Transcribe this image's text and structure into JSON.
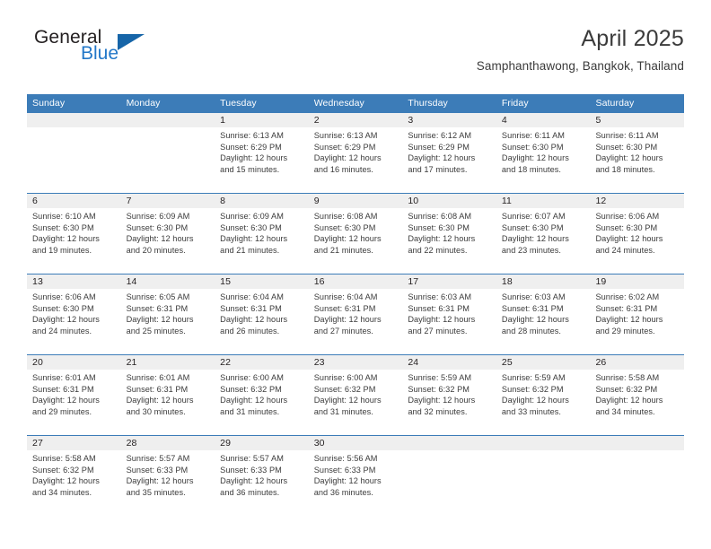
{
  "brand": {
    "name_part1": "General",
    "name_part2": "Blue",
    "flag_icon": "blue-flag-triangle-icon"
  },
  "header": {
    "title": "April 2025",
    "subtitle": "Samphanthawong, Bangkok, Thailand"
  },
  "colors": {
    "header_blue": "#3c7cb8",
    "brand_blue": "#2277c8",
    "flag_blue": "#1665a8",
    "daynum_band": "#efefef",
    "text": "#3b3b3b"
  },
  "weekdays": [
    "Sunday",
    "Monday",
    "Tuesday",
    "Wednesday",
    "Thursday",
    "Friday",
    "Saturday"
  ],
  "weeks": [
    [
      {
        "day": "",
        "lines": []
      },
      {
        "day": "",
        "lines": []
      },
      {
        "day": "1",
        "lines": [
          "Sunrise: 6:13 AM",
          "Sunset: 6:29 PM",
          "Daylight: 12 hours",
          "and 15 minutes."
        ]
      },
      {
        "day": "2",
        "lines": [
          "Sunrise: 6:13 AM",
          "Sunset: 6:29 PM",
          "Daylight: 12 hours",
          "and 16 minutes."
        ]
      },
      {
        "day": "3",
        "lines": [
          "Sunrise: 6:12 AM",
          "Sunset: 6:29 PM",
          "Daylight: 12 hours",
          "and 17 minutes."
        ]
      },
      {
        "day": "4",
        "lines": [
          "Sunrise: 6:11 AM",
          "Sunset: 6:30 PM",
          "Daylight: 12 hours",
          "and 18 minutes."
        ]
      },
      {
        "day": "5",
        "lines": [
          "Sunrise: 6:11 AM",
          "Sunset: 6:30 PM",
          "Daylight: 12 hours",
          "and 18 minutes."
        ]
      }
    ],
    [
      {
        "day": "6",
        "lines": [
          "Sunrise: 6:10 AM",
          "Sunset: 6:30 PM",
          "Daylight: 12 hours",
          "and 19 minutes."
        ]
      },
      {
        "day": "7",
        "lines": [
          "Sunrise: 6:09 AM",
          "Sunset: 6:30 PM",
          "Daylight: 12 hours",
          "and 20 minutes."
        ]
      },
      {
        "day": "8",
        "lines": [
          "Sunrise: 6:09 AM",
          "Sunset: 6:30 PM",
          "Daylight: 12 hours",
          "and 21 minutes."
        ]
      },
      {
        "day": "9",
        "lines": [
          "Sunrise: 6:08 AM",
          "Sunset: 6:30 PM",
          "Daylight: 12 hours",
          "and 21 minutes."
        ]
      },
      {
        "day": "10",
        "lines": [
          "Sunrise: 6:08 AM",
          "Sunset: 6:30 PM",
          "Daylight: 12 hours",
          "and 22 minutes."
        ]
      },
      {
        "day": "11",
        "lines": [
          "Sunrise: 6:07 AM",
          "Sunset: 6:30 PM",
          "Daylight: 12 hours",
          "and 23 minutes."
        ]
      },
      {
        "day": "12",
        "lines": [
          "Sunrise: 6:06 AM",
          "Sunset: 6:30 PM",
          "Daylight: 12 hours",
          "and 24 minutes."
        ]
      }
    ],
    [
      {
        "day": "13",
        "lines": [
          "Sunrise: 6:06 AM",
          "Sunset: 6:30 PM",
          "Daylight: 12 hours",
          "and 24 minutes."
        ]
      },
      {
        "day": "14",
        "lines": [
          "Sunrise: 6:05 AM",
          "Sunset: 6:31 PM",
          "Daylight: 12 hours",
          "and 25 minutes."
        ]
      },
      {
        "day": "15",
        "lines": [
          "Sunrise: 6:04 AM",
          "Sunset: 6:31 PM",
          "Daylight: 12 hours",
          "and 26 minutes."
        ]
      },
      {
        "day": "16",
        "lines": [
          "Sunrise: 6:04 AM",
          "Sunset: 6:31 PM",
          "Daylight: 12 hours",
          "and 27 minutes."
        ]
      },
      {
        "day": "17",
        "lines": [
          "Sunrise: 6:03 AM",
          "Sunset: 6:31 PM",
          "Daylight: 12 hours",
          "and 27 minutes."
        ]
      },
      {
        "day": "18",
        "lines": [
          "Sunrise: 6:03 AM",
          "Sunset: 6:31 PM",
          "Daylight: 12 hours",
          "and 28 minutes."
        ]
      },
      {
        "day": "19",
        "lines": [
          "Sunrise: 6:02 AM",
          "Sunset: 6:31 PM",
          "Daylight: 12 hours",
          "and 29 minutes."
        ]
      }
    ],
    [
      {
        "day": "20",
        "lines": [
          "Sunrise: 6:01 AM",
          "Sunset: 6:31 PM",
          "Daylight: 12 hours",
          "and 29 minutes."
        ]
      },
      {
        "day": "21",
        "lines": [
          "Sunrise: 6:01 AM",
          "Sunset: 6:31 PM",
          "Daylight: 12 hours",
          "and 30 minutes."
        ]
      },
      {
        "day": "22",
        "lines": [
          "Sunrise: 6:00 AM",
          "Sunset: 6:32 PM",
          "Daylight: 12 hours",
          "and 31 minutes."
        ]
      },
      {
        "day": "23",
        "lines": [
          "Sunrise: 6:00 AM",
          "Sunset: 6:32 PM",
          "Daylight: 12 hours",
          "and 31 minutes."
        ]
      },
      {
        "day": "24",
        "lines": [
          "Sunrise: 5:59 AM",
          "Sunset: 6:32 PM",
          "Daylight: 12 hours",
          "and 32 minutes."
        ]
      },
      {
        "day": "25",
        "lines": [
          "Sunrise: 5:59 AM",
          "Sunset: 6:32 PM",
          "Daylight: 12 hours",
          "and 33 minutes."
        ]
      },
      {
        "day": "26",
        "lines": [
          "Sunrise: 5:58 AM",
          "Sunset: 6:32 PM",
          "Daylight: 12 hours",
          "and 34 minutes."
        ]
      }
    ],
    [
      {
        "day": "27",
        "lines": [
          "Sunrise: 5:58 AM",
          "Sunset: 6:32 PM",
          "Daylight: 12 hours",
          "and 34 minutes."
        ]
      },
      {
        "day": "28",
        "lines": [
          "Sunrise: 5:57 AM",
          "Sunset: 6:33 PM",
          "Daylight: 12 hours",
          "and 35 minutes."
        ]
      },
      {
        "day": "29",
        "lines": [
          "Sunrise: 5:57 AM",
          "Sunset: 6:33 PM",
          "Daylight: 12 hours",
          "and 36 minutes."
        ]
      },
      {
        "day": "30",
        "lines": [
          "Sunrise: 5:56 AM",
          "Sunset: 6:33 PM",
          "Daylight: 12 hours",
          "and 36 minutes."
        ]
      },
      {
        "day": "",
        "lines": []
      },
      {
        "day": "",
        "lines": []
      },
      {
        "day": "",
        "lines": []
      }
    ]
  ]
}
